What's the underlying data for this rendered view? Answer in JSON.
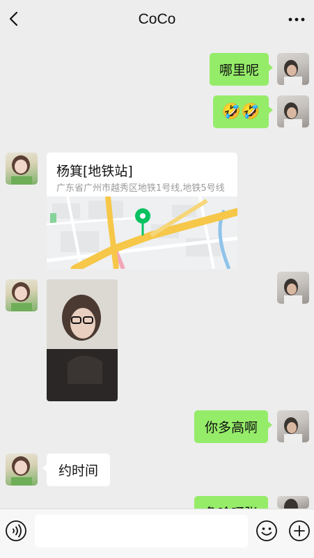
{
  "header": {
    "title": "CoCo",
    "back_icon": "chevron-left-icon",
    "more_icon": "more-dots-icon"
  },
  "messages": {
    "m1": {
      "text": "哪里呢",
      "side": "out"
    },
    "m2": {
      "text": "🤣🤣",
      "side": "out"
    },
    "m3": {
      "type": "location",
      "side": "in",
      "name": "杨箕[地铁站]",
      "address": "广东省广州市越秀区地铁1号线,地铁5号线"
    },
    "m4": {
      "type": "image",
      "side": "in"
    },
    "m5": {
      "text": "你多高啊",
      "side": "out"
    },
    "m6": {
      "text": "约时间",
      "side": "in"
    },
    "m7": {
      "text": "急啥呀张",
      "side": "out",
      "partially_visible": true
    }
  },
  "input_bar": {
    "placeholder": "",
    "value": "",
    "voice_icon": "voice-icon",
    "emoji_icon": "emoji-icon",
    "plus_icon": "plus-icon"
  },
  "colors": {
    "background": "#ededed",
    "outgoing_bubble": "#95ec69",
    "incoming_bubble": "#ffffff",
    "map_pin": "#07c160"
  }
}
